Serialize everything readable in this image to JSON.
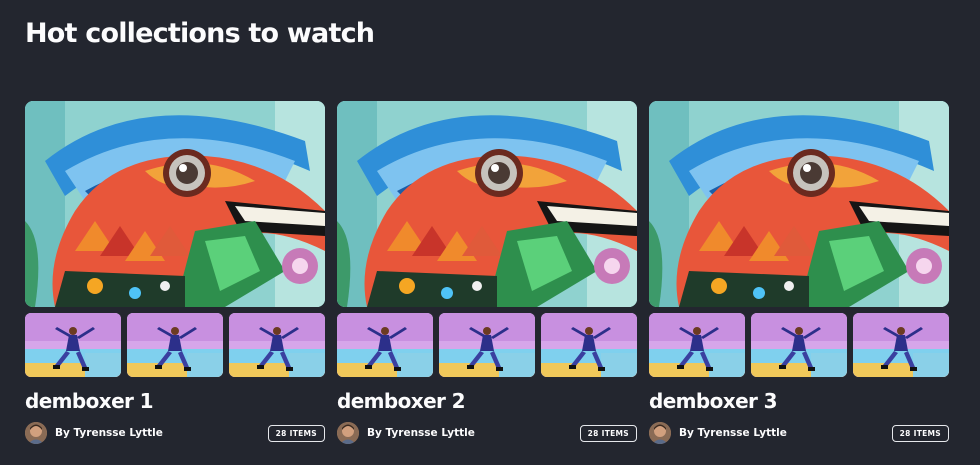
{
  "section": {
    "title": "Hot collections to watch"
  },
  "collections": [
    {
      "title": "demboxer 1",
      "author": "By Tyrensse Lyttle",
      "items_label": "28 ITEMS"
    },
    {
      "title": "demboxer 2",
      "author": "By Tyrensse Lyttle",
      "items_label": "28 ITEMS"
    },
    {
      "title": "demboxer 3",
      "author": "By Tyrensse Lyttle",
      "items_label": "28 ITEMS"
    }
  ],
  "colors": {
    "background": "#23262f",
    "text": "#fcfcfd",
    "badge_border": "#e6e8ec"
  }
}
